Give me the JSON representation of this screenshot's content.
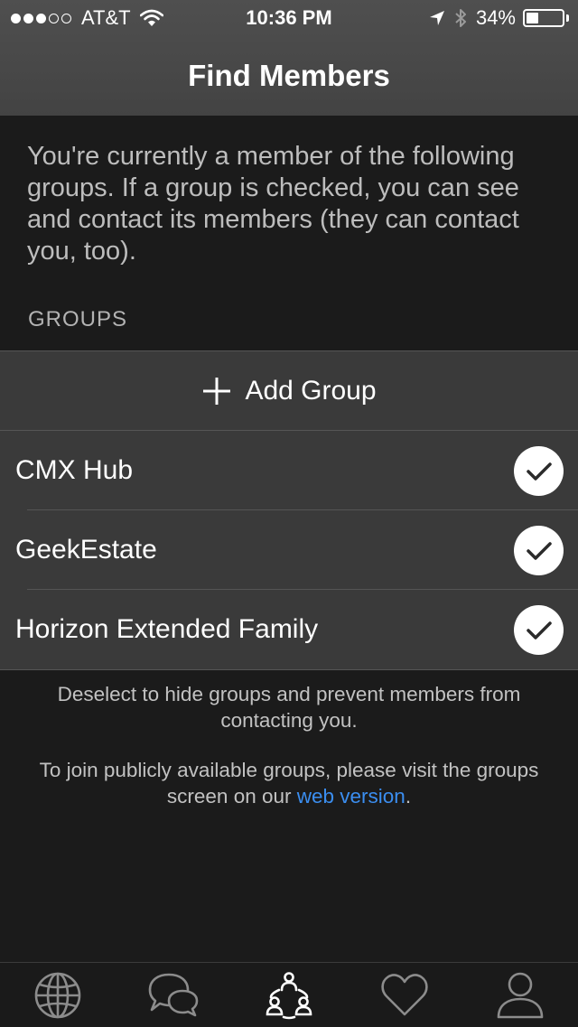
{
  "status_bar": {
    "carrier": "AT&T",
    "time": "10:36 PM",
    "battery_percent": "34%",
    "battery_level": 0.34,
    "signal_bars_filled": 3,
    "signal_bars_total": 5
  },
  "nav": {
    "title": "Find Members"
  },
  "intro": {
    "text": "You're currently a member of the following groups. If a group is checked, you can see and contact its members (they can contact you, too)."
  },
  "groups_section": {
    "header": "GROUPS",
    "add_label": "Add Group",
    "items": [
      {
        "name": "CMX Hub",
        "checked": true
      },
      {
        "name": "GeekEstate",
        "checked": true
      },
      {
        "name": "Horizon Extended Family",
        "checked": true
      }
    ]
  },
  "notes": {
    "deselect": "Deselect to hide groups and prevent members from contacting you.",
    "join_prefix": "To join publicly available groups, please visit the groups screen on our ",
    "join_link": "web version",
    "join_suffix": "."
  },
  "colors": {
    "accent_link": "#3b8ef0",
    "background": "#1b1b1b",
    "header": "#4a4a4a",
    "row": "#3a3a3a"
  },
  "tabbar": {
    "tabs": [
      {
        "icon": "globe-icon",
        "active": false
      },
      {
        "icon": "chat-bubbles-icon",
        "active": false
      },
      {
        "icon": "members-network-icon",
        "active": true
      },
      {
        "icon": "heart-icon",
        "active": false
      },
      {
        "icon": "person-icon",
        "active": false
      }
    ]
  }
}
